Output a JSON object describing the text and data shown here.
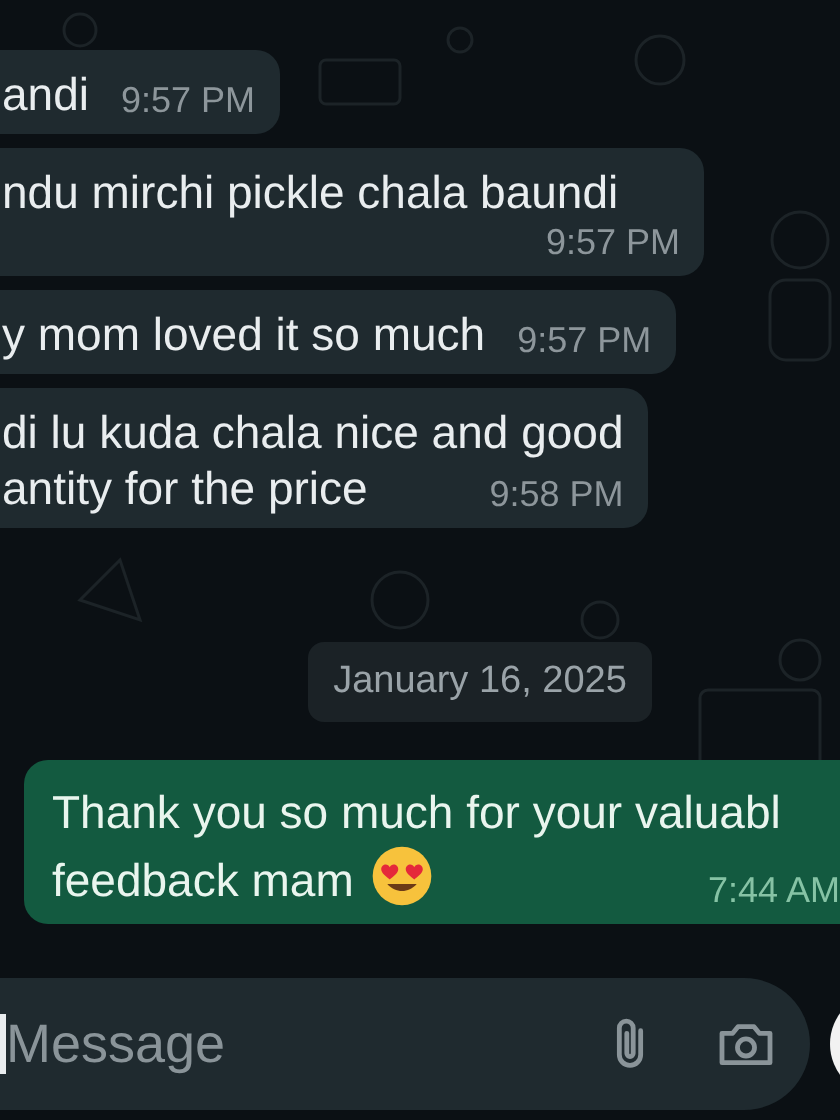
{
  "messages": [
    {
      "kind": "received",
      "lines": [
        "andi"
      ],
      "time": "9:57 PM"
    },
    {
      "kind": "received",
      "lines": [
        "ndu mirchi pickle chala baundi"
      ],
      "time": "9:57 PM"
    },
    {
      "kind": "received",
      "lines": [
        "y mom loved it so much"
      ],
      "time": "9:57 PM"
    },
    {
      "kind": "received",
      "lines": [
        "di lu kuda chala nice and good",
        "antity for the price"
      ],
      "time": "9:58 PM"
    },
    {
      "kind": "date",
      "text": "January 16, 2025"
    },
    {
      "kind": "sent",
      "lines": [
        "Thank you so much for your valuabl",
        "feedback mam"
      ],
      "time": "7:44 AM"
    }
  ],
  "composer": {
    "placeholder": "Message"
  }
}
